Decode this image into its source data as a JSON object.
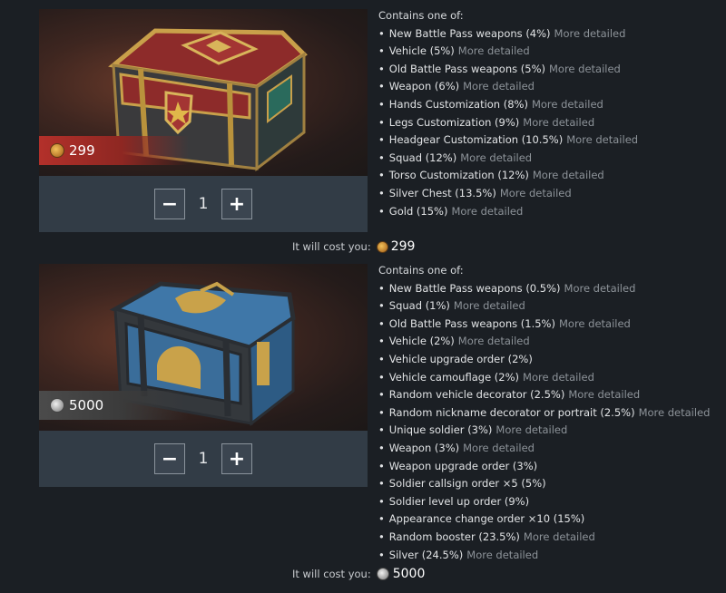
{
  "chest1": {
    "price": "299",
    "currency_icon": "gold-coin-icon",
    "quantity": "1",
    "minus_label": "−",
    "plus_label": "+",
    "contains_header": "Contains one of:",
    "items": [
      {
        "text": "New Battle Pass weapons (4%)",
        "more": "More detailed"
      },
      {
        "text": "Vehicle (5%)",
        "more": "More detailed"
      },
      {
        "text": "Old Battle Pass weapons (5%)",
        "more": "More detailed"
      },
      {
        "text": "Weapon (6%)",
        "more": "More detailed"
      },
      {
        "text": "Hands Customization (8%)",
        "more": "More detailed"
      },
      {
        "text": "Legs Customization (9%)",
        "more": "More detailed"
      },
      {
        "text": "Headgear Customization (10.5%)",
        "more": "More detailed"
      },
      {
        "text": "Squad (12%)",
        "more": "More detailed"
      },
      {
        "text": "Torso Customization (12%)",
        "more": "More detailed"
      },
      {
        "text": "Silver Chest (13.5%)",
        "more": "More detailed"
      },
      {
        "text": "Gold (15%)",
        "more": "More detailed"
      }
    ],
    "cost_label": "It will cost you:",
    "cost_value": "299"
  },
  "chest2": {
    "price": "5000",
    "currency_icon": "silver-coin-icon",
    "quantity": "1",
    "minus_label": "−",
    "plus_label": "+",
    "contains_header": "Contains one of:",
    "items": [
      {
        "text": "New Battle Pass weapons (0.5%)",
        "more": "More detailed"
      },
      {
        "text": "Squad (1%)",
        "more": "More detailed"
      },
      {
        "text": "Old Battle Pass weapons (1.5%)",
        "more": "More detailed"
      },
      {
        "text": "Vehicle (2%)",
        "more": "More detailed"
      },
      {
        "text": "Vehicle upgrade order (2%)",
        "more": ""
      },
      {
        "text": "Vehicle camouflage (2%)",
        "more": "More detailed"
      },
      {
        "text": "Random vehicle decorator (2.5%)",
        "more": "More detailed"
      },
      {
        "text": "Random nickname decorator or portrait (2.5%)",
        "more": "More detailed"
      },
      {
        "text": "Unique soldier (3%)",
        "more": "More detailed"
      },
      {
        "text": "Weapon (3%)",
        "more": "More detailed"
      },
      {
        "text": "Weapon upgrade order (3%)",
        "more": ""
      },
      {
        "text": "Soldier callsign order ×5 (5%)",
        "more": ""
      },
      {
        "text": "Soldier level up order (9%)",
        "more": ""
      },
      {
        "text": "Appearance change order ×10 (15%)",
        "more": ""
      },
      {
        "text": "Random booster (23.5%)",
        "more": "More detailed"
      },
      {
        "text": "Silver (24.5%)",
        "more": "More detailed"
      }
    ],
    "cost_label": "It will cost you:",
    "cost_value": "5000"
  },
  "colors": {
    "background": "#1b1f24",
    "gold_tag": "#b3302a",
    "silver_tag": "#4b4b4b",
    "qty_bar": "#323c46",
    "more_link": "#8d9399"
  }
}
